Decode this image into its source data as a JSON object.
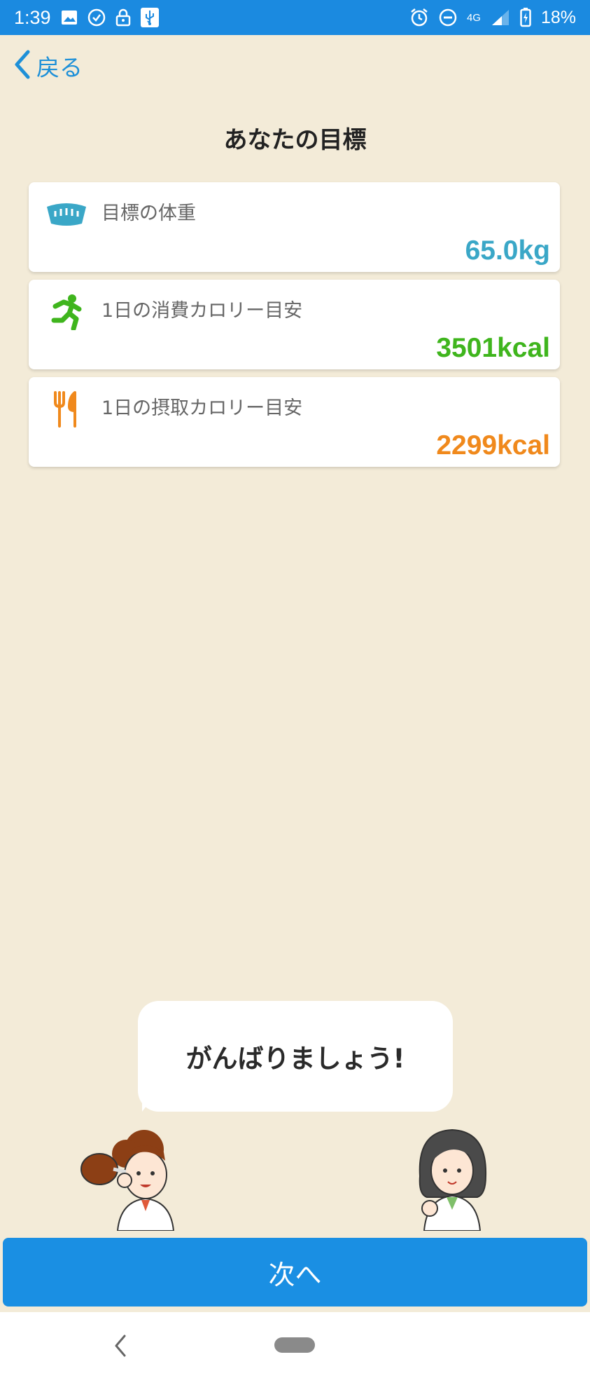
{
  "status_bar": {
    "time": "1:39",
    "network": "4G",
    "battery_percent": "18%",
    "icons_left": [
      "image-icon",
      "check-circle-icon",
      "lock-icon",
      "usb-icon"
    ],
    "icons_right": [
      "alarm-icon",
      "do-not-disturb-icon",
      "signal-icon",
      "battery-charging-icon"
    ]
  },
  "header": {
    "back_label": "戻る",
    "title": "あなたの目標"
  },
  "goals": [
    {
      "icon": "scale-icon",
      "label": "目標の体重",
      "value": "65.0kg",
      "color": "#3aa7c7"
    },
    {
      "icon": "running-icon",
      "label": "1日の消費カロリー目安",
      "value": "3501kcal",
      "color": "#3fb51d"
    },
    {
      "icon": "fork-knife-icon",
      "label": "1日の摂取カロリー目安",
      "value": "2299kcal",
      "color": "#f0891c"
    }
  ],
  "speech": {
    "text": "がんばりましょう!"
  },
  "next_button": {
    "label": "次へ"
  },
  "colors": {
    "background": "#f3ebd8",
    "accent": "#1a8fe3"
  }
}
